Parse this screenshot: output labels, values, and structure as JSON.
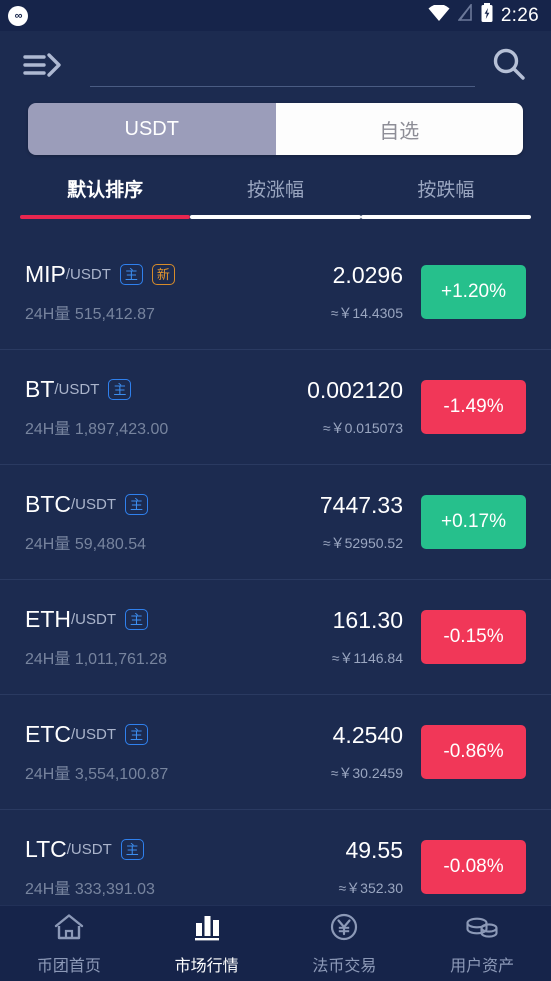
{
  "statusbar": {
    "app_icon": "app-logo-icon",
    "wifi_icon": "wifi-icon",
    "signal_icon": "signal-off-icon",
    "battery_icon": "battery-charging-icon",
    "time": "2:26"
  },
  "header": {
    "menu_icon": "menu-arrow-icon",
    "search_icon": "search-icon",
    "search_value": "",
    "search_placeholder": ""
  },
  "segmented": {
    "tabs": [
      {
        "label": "USDT",
        "active": true
      },
      {
        "label": "自选",
        "active": false
      }
    ]
  },
  "sort_tabs": [
    {
      "label": "默认排序",
      "active": true
    },
    {
      "label": "按涨幅",
      "active": false
    },
    {
      "label": "按跌幅",
      "active": false
    }
  ],
  "list": {
    "volume_label": "24H量",
    "approx_symbol": "≈￥",
    "rows": [
      {
        "symbol": "MIP",
        "quote": "/USDT",
        "badges": [
          "主",
          "新"
        ],
        "volume": "515,412.87",
        "price": "2.0296",
        "cny": "≈￥14.4305",
        "change": "+1.20%",
        "direction": "up"
      },
      {
        "symbol": "BT",
        "quote": "/USDT",
        "badges": [
          "主"
        ],
        "volume": "1,897,423.00",
        "price": "0.002120",
        "cny": "≈￥0.015073",
        "change": "-1.49%",
        "direction": "down"
      },
      {
        "symbol": "BTC",
        "quote": "/USDT",
        "badges": [
          "主"
        ],
        "volume": "59,480.54",
        "price": "7447.33",
        "cny": "≈￥52950.52",
        "change": "+0.17%",
        "direction": "up"
      },
      {
        "symbol": "ETH",
        "quote": "/USDT",
        "badges": [
          "主"
        ],
        "volume": "1,011,761.28",
        "price": "161.30",
        "cny": "≈￥1146.84",
        "change": "-0.15%",
        "direction": "down"
      },
      {
        "symbol": "ETC",
        "quote": "/USDT",
        "badges": [
          "主"
        ],
        "volume": "3,554,100.87",
        "price": "4.2540",
        "cny": "≈￥30.2459",
        "change": "-0.86%",
        "direction": "down"
      },
      {
        "symbol": "LTC",
        "quote": "/USDT",
        "badges": [
          "主"
        ],
        "volume": "333,391.03",
        "price": "49.55",
        "cny": "≈￥352.30",
        "change": "-0.08%",
        "direction": "down"
      }
    ]
  },
  "bottom_nav": [
    {
      "label": "币团首页",
      "icon": "home-icon",
      "active": false
    },
    {
      "label": "市场行情",
      "icon": "bar-chart-icon",
      "active": true
    },
    {
      "label": "法币交易",
      "icon": "yen-circle-icon",
      "active": false
    },
    {
      "label": "用户资产",
      "icon": "coins-icon",
      "active": false
    }
  ],
  "colors": {
    "background": "#1c2b50",
    "statusbar": "#16244a",
    "up": "#26c08c",
    "down": "#f13758",
    "accent_underline": "#e8264f",
    "badge_main": "#3c8ef0",
    "badge_new": "#e0952f"
  }
}
